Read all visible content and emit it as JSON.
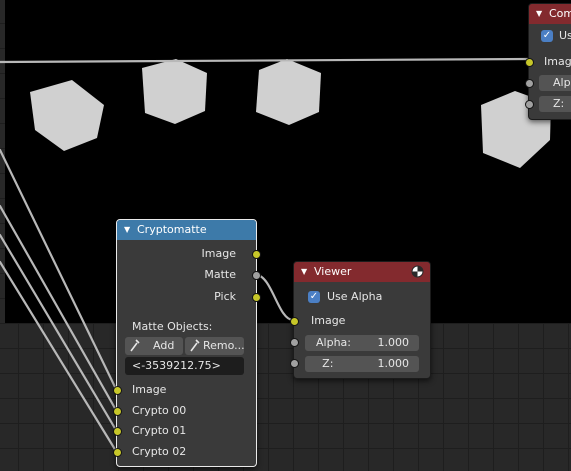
{
  "colors": {
    "cryptomatte_header": "#3d7aa9",
    "viewer_header": "#832a2e",
    "composite_header": "#832a2e",
    "image_socket": "#c7c729",
    "value_socket": "#a1a1a1",
    "checkbox": "#4b7fc4",
    "wire": "#b8b8b8"
  },
  "cryptomatte": {
    "title": "Cryptomatte",
    "outputs": [
      "Image",
      "Matte",
      "Pick"
    ],
    "matte_objects_label": "Matte Objects:",
    "add_label": "Add",
    "remove_label": "Remo...",
    "matte_id_value": "<-3539212.75>",
    "inputs": [
      "Image",
      "Crypto 00",
      "Crypto 01",
      "Crypto 02"
    ]
  },
  "viewer": {
    "title": "Viewer",
    "use_alpha_label": "Use Alpha",
    "use_alpha_checked": true,
    "image_label": "Image",
    "alpha_label": "Alpha:",
    "alpha_value": "1.000",
    "z_label": "Z:",
    "z_value": "1.000"
  },
  "composite": {
    "title": "Com",
    "use_alpha_label": "Us",
    "image_label": "Image",
    "alpha_label": "Alph",
    "z_label": "Z:"
  }
}
